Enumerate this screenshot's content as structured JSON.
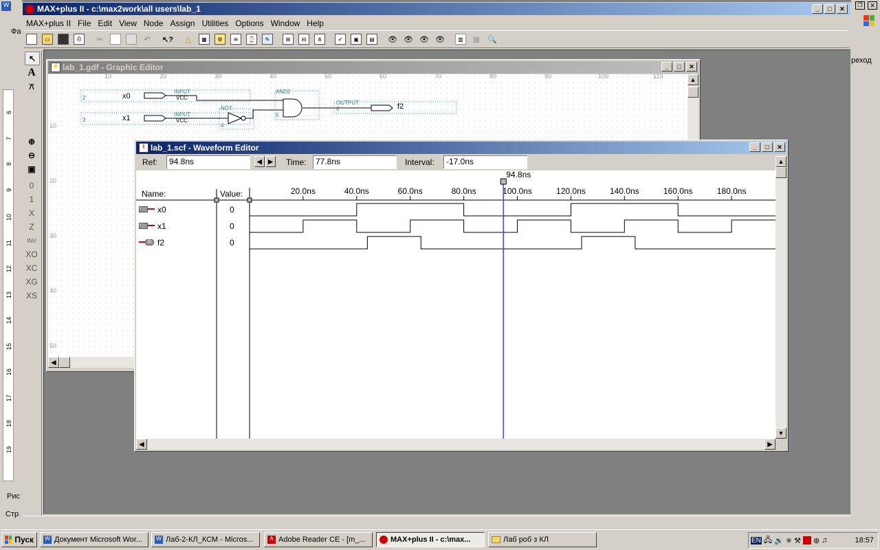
{
  "app": {
    "title": "MAX+plus II - c:\\max2work\\all users\\lab_1",
    "menu": [
      "MAX+plus II",
      "File",
      "Edit",
      "View",
      "Node",
      "Assign",
      "Utilities",
      "Options",
      "Window",
      "Help"
    ]
  },
  "graphic_editor": {
    "title": "lab_1.gdf - Graphic Editor",
    "ruler_top": [
      "10",
      "20",
      "30",
      "40",
      "50",
      "60",
      "70",
      "80",
      "90",
      "100",
      "110"
    ],
    "ruler_left": [
      "10",
      "20",
      "30",
      "40",
      "50"
    ],
    "inputs": [
      {
        "name": "x0",
        "tag": "INPUT",
        "sub": "VCC",
        "num": "2"
      },
      {
        "name": "x1",
        "tag": "INPUT",
        "sub": "VCC",
        "num": "3"
      }
    ],
    "not_gate": {
      "tag": "NOT",
      "num": "4"
    },
    "and_gate": {
      "tag": "AND2",
      "num": "5"
    },
    "output": {
      "name": "f2",
      "tag": "OUTPUT",
      "num": "6"
    }
  },
  "waveform_editor": {
    "title": "lab_1.scf - Waveform Editor",
    "ref_label": "Ref:",
    "ref_value": "94.8ns",
    "time_label": "Time:",
    "time_value": "77.8ns",
    "interval_label": "Interval:",
    "interval_value": "-17.0ns",
    "cursor_label": "94.8ns",
    "name_header": "Name:",
    "value_header": "Value:",
    "time_ticks": [
      "20.0ns",
      "40.0ns",
      "60.0ns",
      "80.0ns",
      "100.0ns",
      "120.0ns",
      "140.0ns",
      "160.0ns",
      "180.0ns",
      "20"
    ],
    "signals": [
      {
        "name": "x0",
        "value": "0",
        "kind": "input",
        "edges_ns": [
          40,
          80,
          120,
          160
        ]
      },
      {
        "name": "x1",
        "value": "0",
        "kind": "input",
        "edges_ns": [
          20,
          40,
          60,
          80,
          100,
          120,
          140,
          160,
          180
        ]
      },
      {
        "name": "f2",
        "value": "0",
        "kind": "output",
        "edges_ns": [
          44,
          64,
          124,
          144
        ]
      }
    ]
  },
  "left_fragment": {
    "ruler_numbers": [
      "6",
      "7",
      "8",
      "9",
      "10",
      "11",
      "12",
      "13",
      "14",
      "15",
      "16",
      "17",
      "18",
      "19"
    ],
    "texts": [
      "Фа",
      "Рис",
      "Стр"
    ]
  },
  "right_fragment": {
    "text": "реход"
  },
  "taskbar": {
    "start_label": "Пуск",
    "buttons": [
      "Документ Microsoft Wor...",
      "Лаб-2-КЛ_КСМ - Micros...",
      "Adobe Reader CE - [m_...",
      "MAX+plus II - c:\\max...",
      "Лаб роб з КЛ"
    ],
    "lang": "EN",
    "clock": "18:57"
  },
  "colors": {
    "title_active": "#0a246a",
    "cursor": "#4040ff",
    "wave": "#000000",
    "desktop": "#808080"
  }
}
